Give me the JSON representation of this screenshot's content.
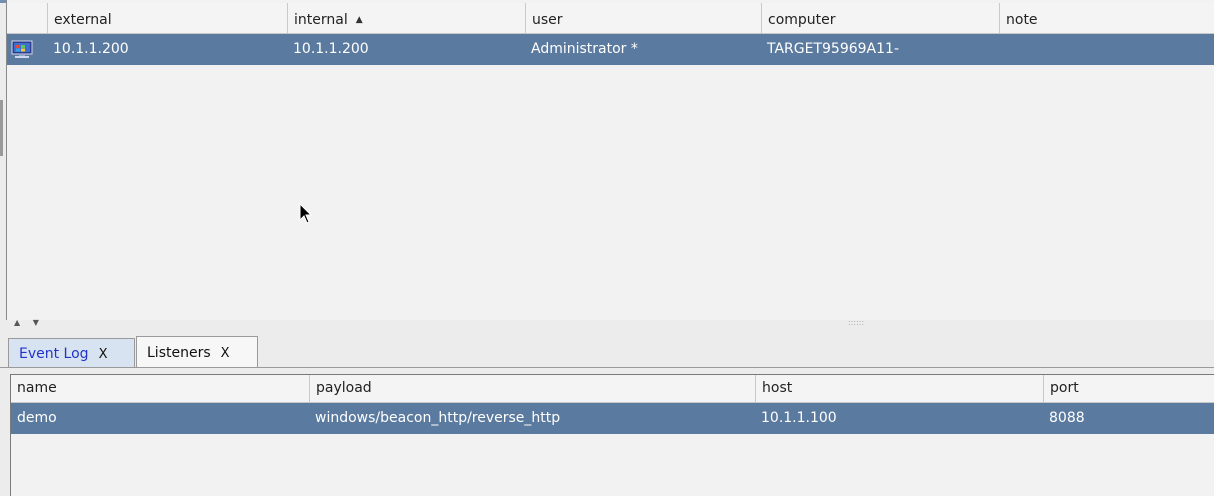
{
  "sessions_table": {
    "columns": [
      {
        "key": "external",
        "label": "external"
      },
      {
        "key": "internal",
        "label": "internal",
        "sort": "ascending"
      },
      {
        "key": "user",
        "label": "user"
      },
      {
        "key": "computer",
        "label": "computer"
      },
      {
        "key": "note",
        "label": "note"
      }
    ],
    "rows": [
      {
        "icon": "windows-host-icon",
        "external": "10.1.1.200",
        "internal": "10.1.1.200",
        "user": "Administrator *",
        "computer": "TARGET95969A11-",
        "note": ""
      }
    ],
    "selected_row": 0,
    "sort_glyph": "▲"
  },
  "tabs": [
    {
      "label": "Event Log",
      "close": "X",
      "active": false
    },
    {
      "label": "Listeners",
      "close": "X",
      "active": true
    }
  ],
  "listeners_table": {
    "columns": [
      {
        "key": "name",
        "label": "name"
      },
      {
        "key": "payload",
        "label": "payload"
      },
      {
        "key": "host",
        "label": "host"
      },
      {
        "key": "port",
        "label": "port"
      }
    ],
    "rows": [
      {
        "name": "demo",
        "payload": "windows/beacon_http/reverse_http",
        "host": "10.1.1.100",
        "port": "8088"
      }
    ],
    "selected_row": 0
  },
  "splitter": {
    "arrows": "▲ ▼",
    "grip": "::::::"
  },
  "colors": {
    "selection": "#5b7a9f",
    "active_tab_text": "#2233cc",
    "inactive_tab_bg": "#d7e3f0"
  }
}
